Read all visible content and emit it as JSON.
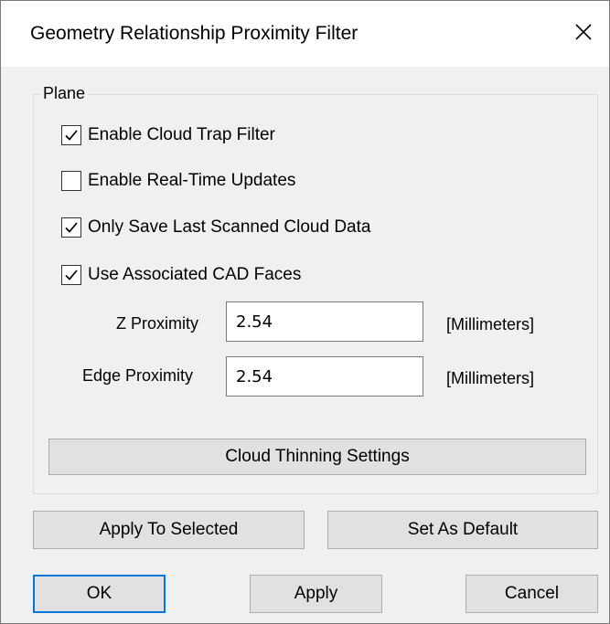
{
  "dialog": {
    "title": "Geometry Relationship Proximity Filter",
    "close_icon": "close-icon"
  },
  "plane_group": {
    "label": "Plane",
    "options": [
      {
        "label": "Enable Cloud Trap Filter",
        "checked": true
      },
      {
        "label": "Enable Real-Time Updates",
        "checked": false
      },
      {
        "label": "Only Save Last Scanned Cloud Data",
        "checked": true
      },
      {
        "label": "Use Associated CAD Faces",
        "checked": true
      }
    ],
    "z_proximity": {
      "label": "Z Proximity",
      "value": "2.54",
      "unit": "[Millimeters]"
    },
    "edge_proximity": {
      "label": "Edge Proximity",
      "value": "2.54",
      "unit": "[Millimeters]"
    },
    "cloud_thinning_button": "Cloud Thinning Settings"
  },
  "actions": {
    "apply_to_selected": "Apply To Selected",
    "set_as_default": "Set As Default",
    "ok": "OK",
    "apply": "Apply",
    "cancel": "Cancel"
  },
  "colors": {
    "dialog_background": "#f0f0f0",
    "titlebar_background": "#ffffff",
    "default_button_border": "#0078d7",
    "button_face": "#e1e1e1"
  }
}
